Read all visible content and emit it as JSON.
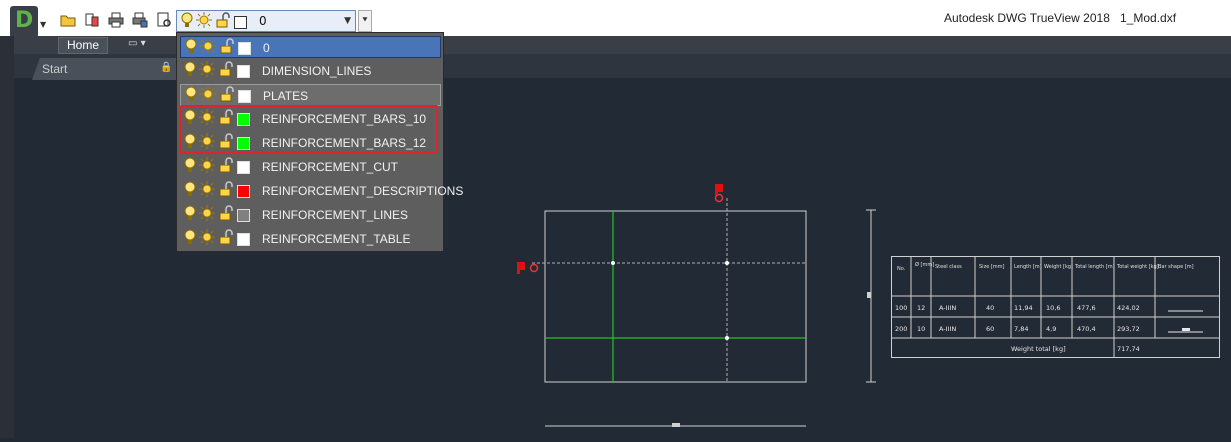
{
  "app": {
    "title": "Autodesk DWG TrueView 2018",
    "file": "1_Mod.dxf",
    "logo_letter": "D"
  },
  "qat": {
    "icons": [
      "open-icon",
      "convert-icon",
      "print-icon",
      "batch-plot-icon",
      "preview-icon"
    ]
  },
  "layer_combo": {
    "current": "0",
    "current_color": "#ffffff"
  },
  "ribbon": {
    "home_tab": "Home",
    "extra_tab": "▾"
  },
  "document_tabs": {
    "start": "Start"
  },
  "colors": {
    "accent": "#4a74b8",
    "highlight": "#e0222a",
    "canvas": "#222a35"
  },
  "layers": [
    {
      "name": "0",
      "color": "#ffffff",
      "state": "selected"
    },
    {
      "name": "DIMENSION_LINES",
      "color": "#ffffff",
      "state": "normal"
    },
    {
      "name": "PLATES",
      "color": "#ffffff",
      "state": "hover"
    },
    {
      "name": "REINFORCEMENT_BARS_10",
      "color": "#00ff00",
      "state": "normal"
    },
    {
      "name": "REINFORCEMENT_BARS_12",
      "color": "#00ff00",
      "state": "normal"
    },
    {
      "name": "REINFORCEMENT_CUT",
      "color": "#ffffff",
      "state": "normal"
    },
    {
      "name": "REINFORCEMENT_DESCRIPTIONS",
      "color": "#ff0000",
      "state": "normal"
    },
    {
      "name": "REINFORCEMENT_LINES",
      "color": "#808080",
      "state": "normal"
    },
    {
      "name": "REINFORCEMENT_TABLE",
      "color": "#ffffff",
      "state": "normal"
    }
  ],
  "drawing_table": {
    "headers": [
      "No.",
      "Ø [mm]",
      "Steel class",
      "Size [mm]",
      "Length [m]",
      "Weight [kg]",
      "Total length [m]",
      "Total weight [kg]",
      "Bar shape [m]"
    ],
    "rows": [
      [
        "100",
        "12",
        "A-IIIN",
        "40",
        "11,94",
        "10,6",
        "477,6",
        "424,02",
        ""
      ],
      [
        "200",
        "10",
        "A-IIIN",
        "60",
        "7,84",
        "4,9",
        "470,4",
        "293,72",
        ""
      ]
    ],
    "total_label": "Weight total [kg]",
    "total_value": "717,74"
  }
}
